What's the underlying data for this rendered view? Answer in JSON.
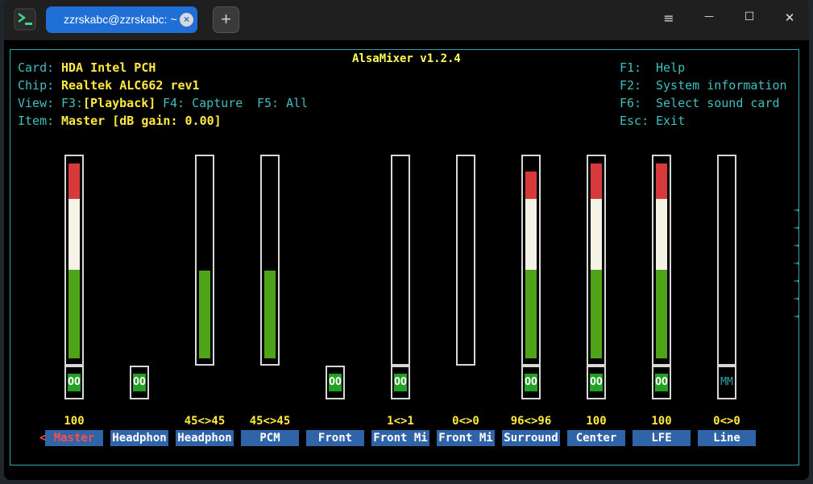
{
  "titlebar": {
    "tab_title": "zzrskabc@zzrskabc: ~",
    "close_tab_glyph": "×",
    "new_tab_glyph": "+",
    "menu_glyph": "≡",
    "minimize_glyph": "—",
    "maximize_glyph": "☐",
    "close_glyph": "✕"
  },
  "mixer": {
    "title": "AlsaMixer v1.2.4",
    "card_label": "Card:",
    "card_value": "HDA Intel PCH",
    "chip_label": "Chip:",
    "chip_value": "Realtek ALC662 rev1",
    "view_label": "View:",
    "view_f3": "F3:",
    "view_playback": "[Playback]",
    "view_f4": "F4: Capture",
    "view_f5": "F5: All",
    "item_label": "Item:",
    "item_value": "Master [dB gain: 0.00]",
    "help": [
      {
        "key": "F1:",
        "label": "Help"
      },
      {
        "key": "F2:",
        "label": "System information"
      },
      {
        "key": "F6:",
        "label": "Select sound card"
      },
      {
        "key": "Esc:",
        "label": "Exit"
      }
    ],
    "selector_arrow": "<",
    "right_arrow": "→",
    "controls": [
      {
        "name": "Master",
        "value": "100",
        "level": 1.0,
        "mute": "OO",
        "selected": true
      },
      {
        "name": "Headphon",
        "value": "",
        "level": null,
        "mute": "OO"
      },
      {
        "name": "Headphon",
        "value": "45<>45",
        "level": 0.45,
        "mute": ""
      },
      {
        "name": "PCM",
        "value": "45<>45",
        "level": 0.45,
        "mute": ""
      },
      {
        "name": "Front",
        "value": "",
        "level": null,
        "mute": "OO"
      },
      {
        "name": "Front Mi",
        "value": "1<>1",
        "level": 0.0,
        "mute": "OO"
      },
      {
        "name": "Front Mi",
        "value": "0<>0",
        "level": 0.0,
        "mute": ""
      },
      {
        "name": "Surround",
        "value": "96<>96",
        "level": 0.96,
        "mute": "OO"
      },
      {
        "name": "Center",
        "value": "100",
        "level": 1.0,
        "mute": "OO"
      },
      {
        "name": "LFE",
        "value": "100",
        "level": 1.0,
        "mute": "OO"
      },
      {
        "name": "Line",
        "value": "0<>0",
        "level": 0.0,
        "mute": "MM",
        "muted": true
      }
    ],
    "colors": {
      "high": "#d63a3a",
      "mid": "#f5f3e6",
      "low": "#4ea319",
      "label_bg": "#2f64a8",
      "border": "#33a5a5"
    }
  }
}
